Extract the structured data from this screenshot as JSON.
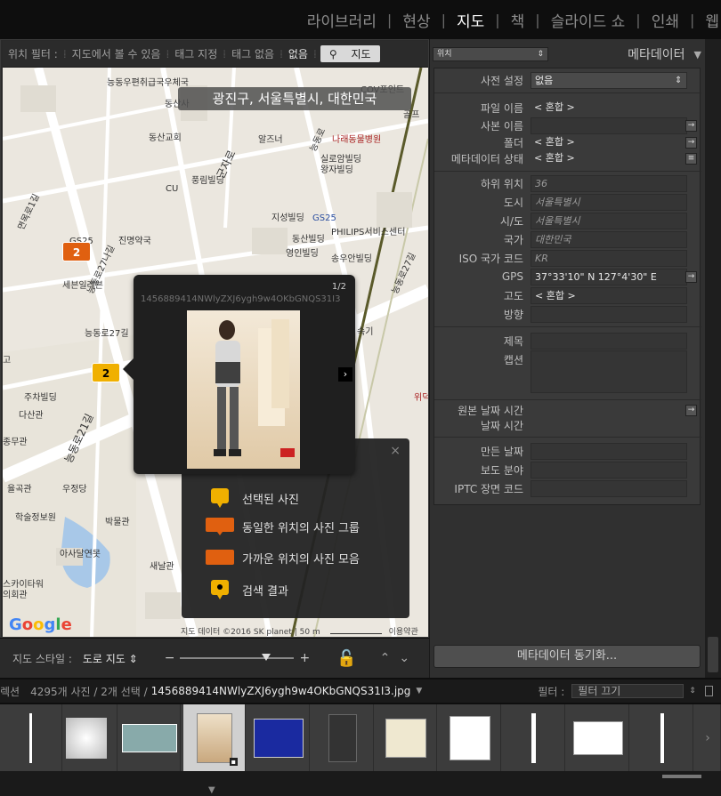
{
  "modules": [
    "라이브러리",
    "현상",
    "지도",
    "책",
    "슬라이드 쇼",
    "인쇄",
    "웹"
  ],
  "active_module": "지도",
  "filter_bar": {
    "label": "위치 필터 :",
    "options": [
      "지도에서 볼 수 있음",
      "태그 지정",
      "태그 없음",
      "없음"
    ],
    "selected": "없음",
    "search_placeholder": "지도"
  },
  "map": {
    "location_title": "광진구, 서울특별시, 대한민국",
    "labels": {
      "l1": "능동우편취급국우체국",
      "l2": "동산교회",
      "l3": "풍림빌딩",
      "l4": "CU",
      "l5": "군자로",
      "l6": "알즈너",
      "l7": "나래동물병원",
      "l8": "실로암빌딩",
      "l9": "왕자빌딩",
      "l10": "면목로1길",
      "l11": "진명약국",
      "l12": "지성빌딩",
      "l13": "동산빌딩",
      "l14": "영인빌딩",
      "l15": "GS25",
      "l16": "PHILIPS서비스센터",
      "l17": "송우안빌딩",
      "l18": "능동로27나길",
      "l19": "세븐일레븐",
      "l20": "능동로27길",
      "l21": "주차빌딩",
      "l22": "다산관",
      "l23": "종무관",
      "l24": "율곡관",
      "l25": "우정당",
      "l26": "학술정보원",
      "l27": "박물관",
      "l28": "아사달연못",
      "l29": "새날관",
      "l30": "동산사",
      "l31": "능동로",
      "l32": "능동로21길",
      "l33": "골프",
      "l34": "COV포인트",
      "l35": "능동로27길",
      "l36": "위덕",
      "l37": "고",
      "l38": "속기",
      "l39": "GS25",
      "l40": "스카이타워",
      "l41": "의회관"
    },
    "marker_count_top": "2",
    "marker_count_selected": "2",
    "popup": {
      "filename": "1456889414NWlyZXJ6ygh9w4OKbGNQS31I3",
      "counter": "1/2"
    },
    "legend": [
      "선택된 사진",
      "동일한 위치의 사진 그룹",
      "가까운 위치의 사진 모음",
      "검색 결과"
    ],
    "attribution": "지도 데이터 ©2016 SK planet",
    "scale": "50 m",
    "terms": "이용약관",
    "google": "Google"
  },
  "style_bar": {
    "label": "지도 스타일 :",
    "value": "도로 지도"
  },
  "metadata_panel": {
    "preset_dropdown": "위치",
    "title": "메타데이터",
    "rows": [
      {
        "label": "사전 설정",
        "value": "없음"
      },
      {
        "label": "파일 이름",
        "value": "< 혼합 >"
      },
      {
        "label": "사본 이름",
        "value": ""
      },
      {
        "label": "폴더",
        "value": "< 혼합 >"
      },
      {
        "label": "메타데이터 상태",
        "value": "< 혼합 >"
      },
      {
        "label": "하위 위치",
        "value": "36"
      },
      {
        "label": "도시",
        "value": "서울특별시"
      },
      {
        "label": "시/도",
        "value": "서울특별시"
      },
      {
        "label": "국가",
        "value": "대한민국"
      },
      {
        "label": "ISO 국가 코드",
        "value": "KR"
      },
      {
        "label": "GPS",
        "value": "37°33'10\" N 127°4'30\" E"
      },
      {
        "label": "고도",
        "value": "< 혼합 >"
      },
      {
        "label": "방향",
        "value": ""
      },
      {
        "label": "제목",
        "value": ""
      },
      {
        "label": "캡션",
        "value": ""
      },
      {
        "label": "원본 날짜 시간",
        "value": ""
      },
      {
        "label": "날짜 시간",
        "value": ""
      },
      {
        "label": "만든 날짜",
        "value": ""
      },
      {
        "label": "보도 분야",
        "value": ""
      },
      {
        "label": "IPTC 장면 코드",
        "value": ""
      }
    ],
    "sync_button": "메타데이터 동기화..."
  },
  "filmstrip_bar": {
    "collection": "렉션",
    "count": "4295개 사진 / 2개 선택 /",
    "filename": "1456889414NWlyZXJ6ygh9w4OKbGNQS31I3.jpg",
    "filter_label": "필터 :",
    "filter_value": "필터 끄기"
  },
  "colors": {
    "accent_orange": "#e06010",
    "accent_yellow": "#f0b000"
  }
}
